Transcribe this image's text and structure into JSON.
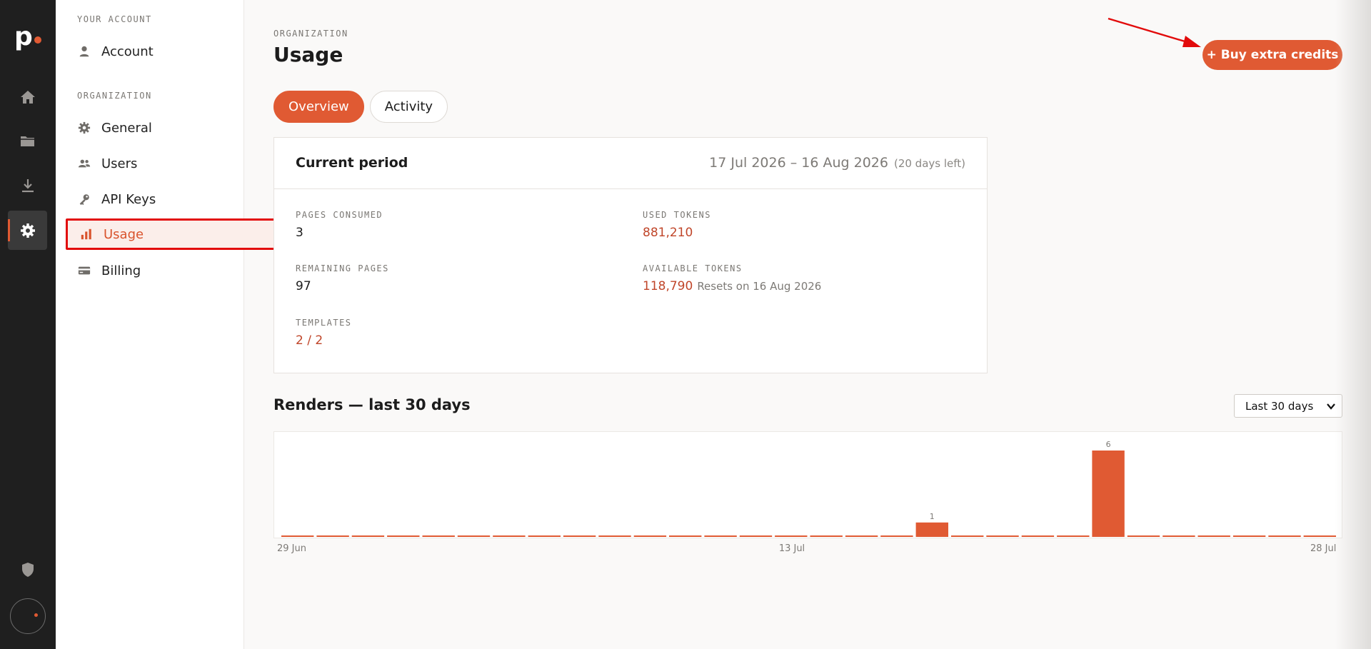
{
  "rail": {
    "logo": "p",
    "items": [
      {
        "name": "home-icon"
      },
      {
        "name": "folder-icon"
      },
      {
        "name": "download-icon"
      },
      {
        "name": "gear-icon"
      }
    ],
    "bottom": [
      {
        "name": "shield-icon"
      }
    ]
  },
  "sidebar": {
    "your_account_heading": "YOUR ACCOUNT",
    "account_label": "Account",
    "organization_heading": "ORGANIZATION",
    "items": [
      {
        "label": "General",
        "icon": "gear-icon"
      },
      {
        "label": "Users",
        "icon": "users-icon"
      },
      {
        "label": "API Keys",
        "icon": "key-icon"
      },
      {
        "label": "Usage",
        "icon": "bar-chart-icon",
        "active": true
      },
      {
        "label": "Billing",
        "icon": "credit-card-icon"
      }
    ]
  },
  "header": {
    "section": "ORGANIZATION",
    "title": "Usage",
    "buy_button": "+ Buy extra credits"
  },
  "tabs": [
    {
      "label": "Overview",
      "active": true
    },
    {
      "label": "Activity",
      "active": false
    }
  ],
  "period_card": {
    "title": "Current period",
    "range": "17 Jul 2026 – 16 Aug 2026",
    "days_left": "(20 days left)",
    "pages_consumed_label": "PAGES CONSUMED",
    "pages_consumed": "3",
    "remaining_pages_label": "REMAINING PAGES",
    "remaining_pages": "97",
    "templates_label": "TEMPLATES",
    "templates": "2 / 2",
    "used_tokens_label": "USED TOKENS",
    "used_tokens": "881,210",
    "available_tokens_label": "AVAILABLE TOKENS",
    "available_tokens": "118,790",
    "resets_note": "Resets on 16 Aug 2026"
  },
  "renders": {
    "title": "Renders — last 30 days",
    "range_select": "Last 30 days"
  },
  "colors": {
    "accent": "#e05a33",
    "accent_text": "#c0462a",
    "rail_bg": "#1f1f1f"
  },
  "chart_data": {
    "type": "bar",
    "x": [
      "29 Jun",
      "30 Jun",
      "1 Jul",
      "2 Jul",
      "3 Jul",
      "4 Jul",
      "5 Jul",
      "6 Jul",
      "7 Jul",
      "8 Jul",
      "9 Jul",
      "10 Jul",
      "11 Jul",
      "12 Jul",
      "13 Jul",
      "14 Jul",
      "15 Jul",
      "16 Jul",
      "17 Jul",
      "18 Jul",
      "19 Jul",
      "20 Jul",
      "21 Jul",
      "22 Jul",
      "23 Jul",
      "24 Jul",
      "25 Jul",
      "26 Jul",
      "27 Jul",
      "28 Jul"
    ],
    "values": [
      0,
      0,
      0,
      0,
      0,
      0,
      0,
      0,
      0,
      0,
      0,
      0,
      0,
      0,
      0,
      0,
      0,
      0,
      1,
      0,
      0,
      0,
      0,
      6,
      0,
      0,
      0,
      0,
      0,
      0
    ],
    "tick_labels": [
      "29 Jun",
      "13 Jul",
      "28 Jul"
    ],
    "ylim": [
      0,
      6
    ],
    "grid": false
  }
}
